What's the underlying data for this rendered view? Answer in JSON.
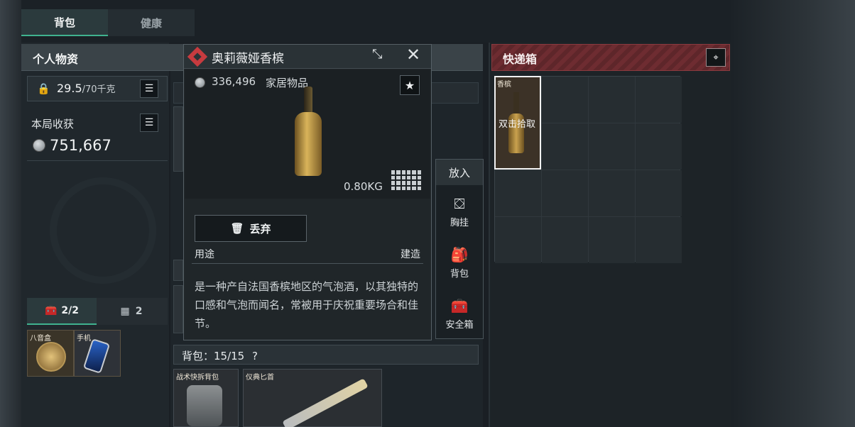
{
  "tabs": {
    "backpack": "背包",
    "health": "健康"
  },
  "personal": {
    "title": "个人物资",
    "weight_value": "29.5",
    "weight_max": "/70千克",
    "harvest_label": "本局收获",
    "harvest_value": "751,667",
    "sub_tab_1": "2/2",
    "sub_tab_2": "2",
    "items": [
      {
        "label": "八音盒"
      },
      {
        "label": "手机"
      }
    ]
  },
  "popup": {
    "title": "奥莉薇娅香槟",
    "price": "336,496",
    "category": "家居物品",
    "weight": "0.80KG",
    "drop_label": "丢弃",
    "use_label": "用途",
    "use_value": "建造",
    "description": "是一种产自法国香槟地区的气泡酒，以其独特的口感和气泡而闻名，常被用于庆祝重要场合和佳节。"
  },
  "put_in": {
    "title": "放入",
    "options": [
      {
        "label": "胸挂",
        "icon": "chest-rig-icon"
      },
      {
        "label": "背包",
        "icon": "backpack-icon"
      },
      {
        "label": "安全箱",
        "icon": "safe-box-icon"
      }
    ]
  },
  "backpack_bar": {
    "label": "背包：15/15"
  },
  "bag_items": [
    {
      "label": "战术快拆背包"
    },
    {
      "label": "仪典匕首"
    }
  ],
  "express_box": {
    "title": "快递箱",
    "item_label": "香槟",
    "pickup_hint": "双击拾取"
  },
  "colors": {
    "accent_green": "#3fb28f",
    "alert_red": "#c73b3f"
  }
}
